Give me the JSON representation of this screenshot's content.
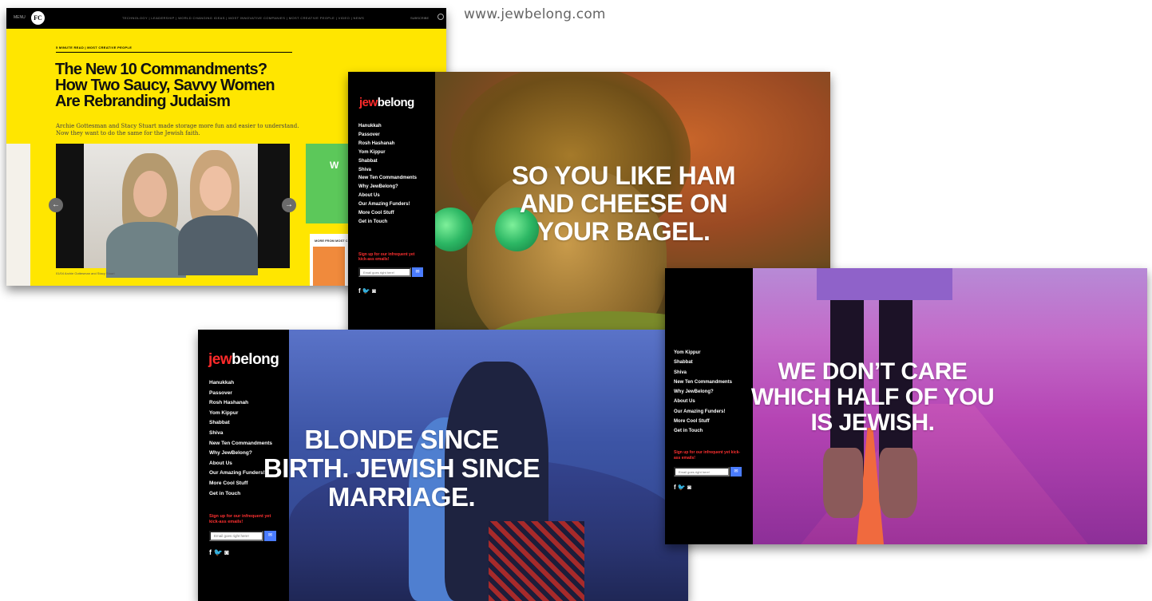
{
  "url": "www.jewbelong.com",
  "fastcompany": {
    "menu": "MENU",
    "logo": "FC",
    "nav": "TECHNOLOGY | LEADERSHIP | WORLD CHANGING IDEAS | MOST INNOVATIVE COMPANIES | MOST CREATIVE PEOPLE | VIDEO | NEWS",
    "subscribe": "SUBSCRIBE",
    "kicker": "5 MINUTE READ | MOST CREATIVE PEOPLE",
    "title": "The New 10 Commandments? How Two Saucy, Savvy Women Are Rebranding Judaism",
    "dek": "Archie Gottesman and Stacy Stuart made storage more fun and easier to understand. Now they want to do the same for the Jewish faith.",
    "prev_arrow": "←",
    "next_arrow": "→",
    "caption": "01/04 Archie Gottesman and Stacy Stuart",
    "more_from": "MORE FROM MOST C",
    "ad_text": "W"
  },
  "jewbelong": {
    "logo_jew": "jew",
    "logo_belong": "belong",
    "nav": [
      "Hanukkah",
      "Passover",
      "Rosh Hashanah",
      "Yom Kippur",
      "Shabbat",
      "Shiva",
      "New Ten Commandments",
      "Why JewBelong?",
      "About Us",
      "Our Amazing Funders!",
      "More Cool Stuff",
      "Get in Touch"
    ],
    "nav_partial": [
      "Yom Kippur",
      "Shabbat",
      "Shiva",
      "New Ten Commandments",
      "Why JewBelong?",
      "About Us",
      "Our Amazing Funders!",
      "More Cool Stuff",
      "Get in Touch"
    ],
    "signup": "Sign up for our infrequent yet kick-ass emails!",
    "email_placeholder": "Email goes right here!",
    "send_icon": "✉",
    "social": "f  🐦  ◙"
  },
  "headlines": {
    "ham": "SO YOU LIKE HAM AND CHEESE ON YOUR BAGEL.",
    "blonde": "BLONDE SINCE BIRTH. JEWISH SINCE MARRIAGE.",
    "half": "WE DON’T CARE WHICH HALF OF YOU IS JEWISH."
  }
}
